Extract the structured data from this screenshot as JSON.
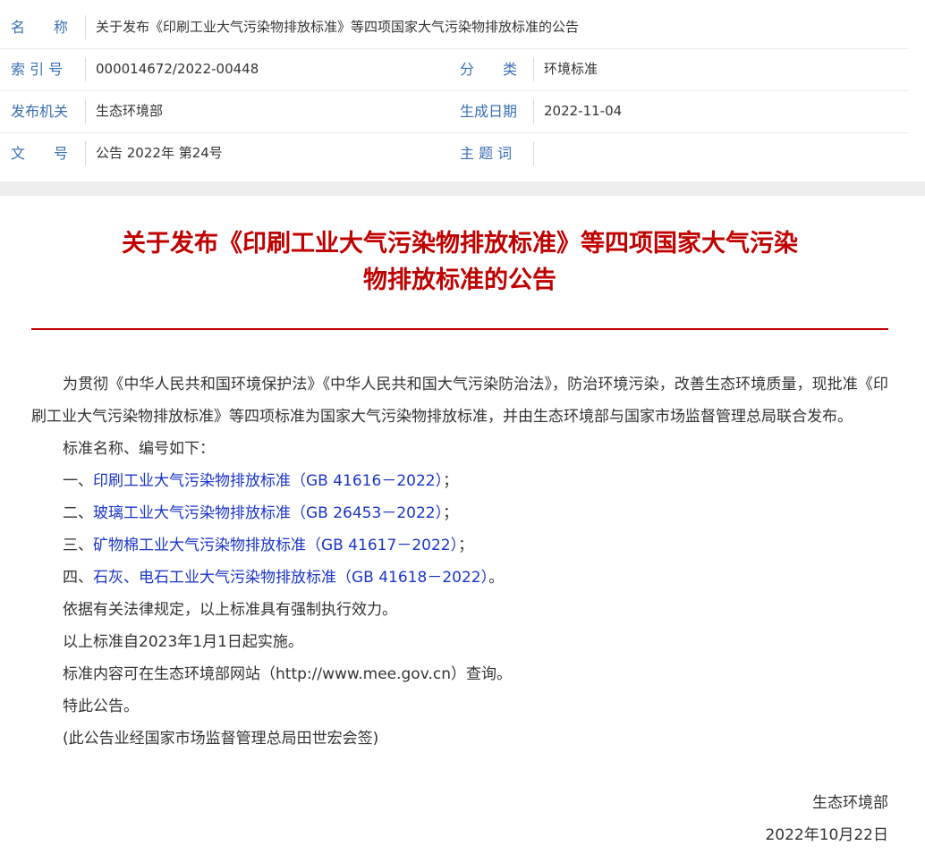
{
  "meta": {
    "name_label": "名　　称",
    "name_value": "关于发布《印刷工业大气污染物排放标准》等四项国家大气污染物排放标准的公告",
    "index_label": "索 引 号",
    "index_value": "000014672/2022-00448",
    "category_label": "分　　类",
    "category_value": "环境标准",
    "issuer_label": "发布机关",
    "issuer_value": "生态环境部",
    "date_label": "生成日期",
    "date_value": "2022-11-04",
    "docno_label": "文　　号",
    "docno_value": "公告 2022年 第24号",
    "subject_label": "主 题 词",
    "subject_value": ""
  },
  "article": {
    "title_line1": "关于发布《印刷工业大气污染物排放标准》等四项国家大气污染",
    "title_line2": "物排放标准的公告",
    "intro": "为贯彻《中华人民共和国环境保护法》《中华人民共和国大气污染防治法》，防治环境污染，改善生态环境质量，现批准《印刷工业大气污染物排放标准》等四项标准为国家大气污染物排放标准，并由生态环境部与国家市场监督管理总局联合发布。",
    "list_intro": "标准名称、编号如下：",
    "standards": [
      {
        "prefix": "一、",
        "link": "印刷工业大气污染物排放标准（GB 41616－2022）",
        "suffix": "；"
      },
      {
        "prefix": "二、",
        "link": "玻璃工业大气污染物排放标准（GB 26453－2022）",
        "suffix": "；"
      },
      {
        "prefix": "三、",
        "link": "矿物棉工业大气污染物排放标准（GB 41617－2022）",
        "suffix": "；"
      },
      {
        "prefix": "四、",
        "link": "石灰、电石工业大气污染物排放标准（GB 41618－2022）",
        "suffix": "。"
      }
    ],
    "p_law": "依据有关法律规定，以上标准具有强制执行效力。",
    "p_effective": "以上标准自2023年1月1日起实施。",
    "p_site": "标准内容可在生态环境部网站（http://www.mee.gov.cn）查询。",
    "p_notice": "特此公告。",
    "p_cosign": "(此公告业经国家市场监督管理总局田世宏会签)",
    "sign_org": "生态环境部",
    "sign_date": "2022年10月22日"
  },
  "colors": {
    "label_blue": "#3a6fb5",
    "title_red": "#c00000",
    "link_blue": "#1a35c9"
  }
}
